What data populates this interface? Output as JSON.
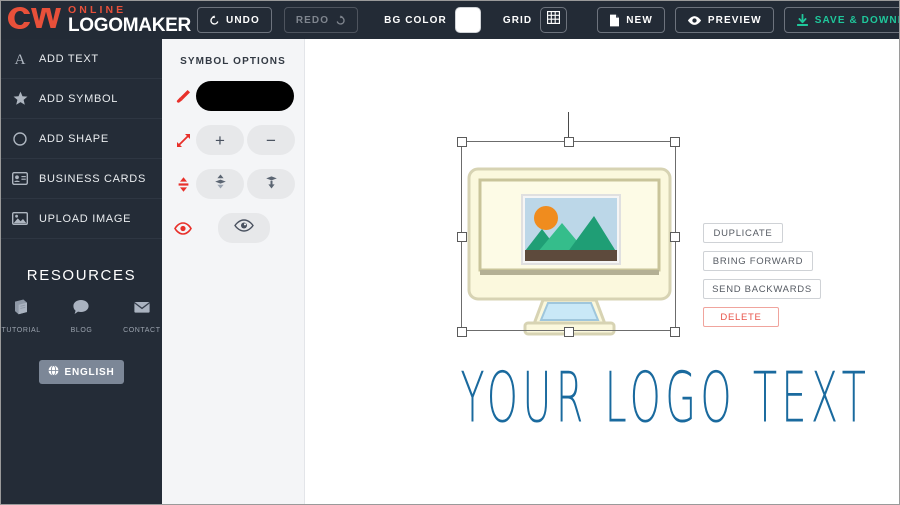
{
  "app": {
    "brand_online": "ONLINE",
    "brand_logomaker": "LOGOMAKER"
  },
  "toolbar": {
    "undo_label": "UNDO",
    "undo_icon": "undo-arrow-icon",
    "redo_label": "REDO",
    "redo_icon": "redo-arrow-icon",
    "redo_disabled": true,
    "bgcolor_label": "BG COLOR",
    "bgcolor_value": "#ffffff",
    "grid_label": "GRID",
    "grid_icon": "grid-3x3-icon",
    "new_label": "NEW",
    "new_icon": "document-icon",
    "preview_label": "PREVIEW",
    "preview_icon": "eye-icon",
    "save_label": "SAVE & DOWNLOAD",
    "save_icon": "download-icon",
    "save_color": "#1fc79b",
    "background": "#232b36"
  },
  "sidebar": {
    "items": [
      {
        "label": "ADD TEXT",
        "icon": "letter-a-icon"
      },
      {
        "label": "ADD SYMBOL",
        "icon": "star-icon"
      },
      {
        "label": "ADD SHAPE",
        "icon": "circle-outline-icon"
      },
      {
        "label": "BUSINESS CARDS",
        "icon": "business-card-icon"
      },
      {
        "label": "UPLOAD IMAGE",
        "icon": "image-upload-icon"
      }
    ],
    "resources_title": "RESOURCES",
    "resources": [
      {
        "label": "TUTORIAL",
        "icon": "book-icon"
      },
      {
        "label": "BLOG",
        "icon": "speech-bubble-icon"
      },
      {
        "label": "CONTACT",
        "icon": "envelope-icon"
      }
    ],
    "language_label": "ENGLISH",
    "language_icon": "globe-icon",
    "background": "#242c37"
  },
  "options_panel": {
    "title": "SYMBOL OPTIONS",
    "color_row": {
      "icon": "paintbrush-icon",
      "swatch_value": "#000000"
    },
    "size_row": {
      "icon": "resize-arrows-icon",
      "increase_label": "+",
      "decrease_label": "−"
    },
    "flip_row": {
      "icon": "flip-arrows-icon",
      "flip_up_icon": "flip-vertical-up-icon",
      "flip_down_icon": "flip-vertical-down-icon"
    },
    "visibility_row": {
      "icon": "eye-outline-icon",
      "toggle_icon": "eye-icon"
    },
    "background": "#f4f5f7",
    "accent": "#e8302a"
  },
  "canvas": {
    "logo_text": "YOUR LOGO TEXT",
    "logo_text_color": "#1a6a9e",
    "selected_object": "monitor-picture-symbol",
    "artwork_colors": {
      "frame_outer": "#e8e6cd",
      "frame_inner": "#fbf6d3",
      "frame_border": "#c9c49a",
      "sky": "#bcd7e8",
      "sun": "#f08c1e",
      "mountain_light": "#35bd8b",
      "mountain_dark": "#1f9e75",
      "ground": "#5d4a3c",
      "stand_glass": "#c9e8f7"
    }
  },
  "context_menu": {
    "items": [
      {
        "label": "DUPLICATE",
        "danger": false
      },
      {
        "label": "BRING FORWARD",
        "danger": false
      },
      {
        "label": "SEND BACKWARDS",
        "danger": false
      },
      {
        "label": "DELETE",
        "danger": true
      }
    ],
    "danger_color": "#e8544a"
  }
}
